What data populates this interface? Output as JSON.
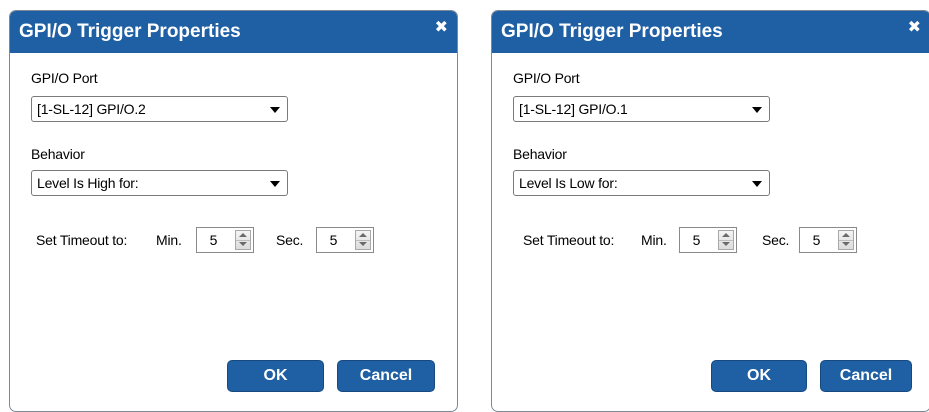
{
  "colors": {
    "titlebar": "#1f5fa3",
    "button": "#1f5fa3",
    "title_text": "#ffffff"
  },
  "dialogs": [
    {
      "title": "GPI/O Trigger Properties",
      "close_icon": "close-icon",
      "port_label": "GPI/O Port",
      "port_value": "[1-SL-12] GPI/O.2",
      "behavior_label": "Behavior",
      "behavior_value": "Level Is High for:",
      "timeout_label": "Set Timeout to:",
      "min_label": "Min.",
      "min_value": "5",
      "sec_label": "Sec.",
      "sec_value": "5",
      "ok_label": "OK",
      "cancel_label": "Cancel"
    },
    {
      "title": "GPI/O Trigger Properties",
      "close_icon": "close-icon",
      "port_label": "GPI/O Port",
      "port_value": "[1-SL-12] GPI/O.1",
      "behavior_label": "Behavior",
      "behavior_value": "Level Is Low for:",
      "timeout_label": "Set Timeout to:",
      "min_label": "Min.",
      "min_value": "5",
      "sec_label": "Sec.",
      "sec_value": "5",
      "ok_label": "OK",
      "cancel_label": "Cancel"
    }
  ]
}
